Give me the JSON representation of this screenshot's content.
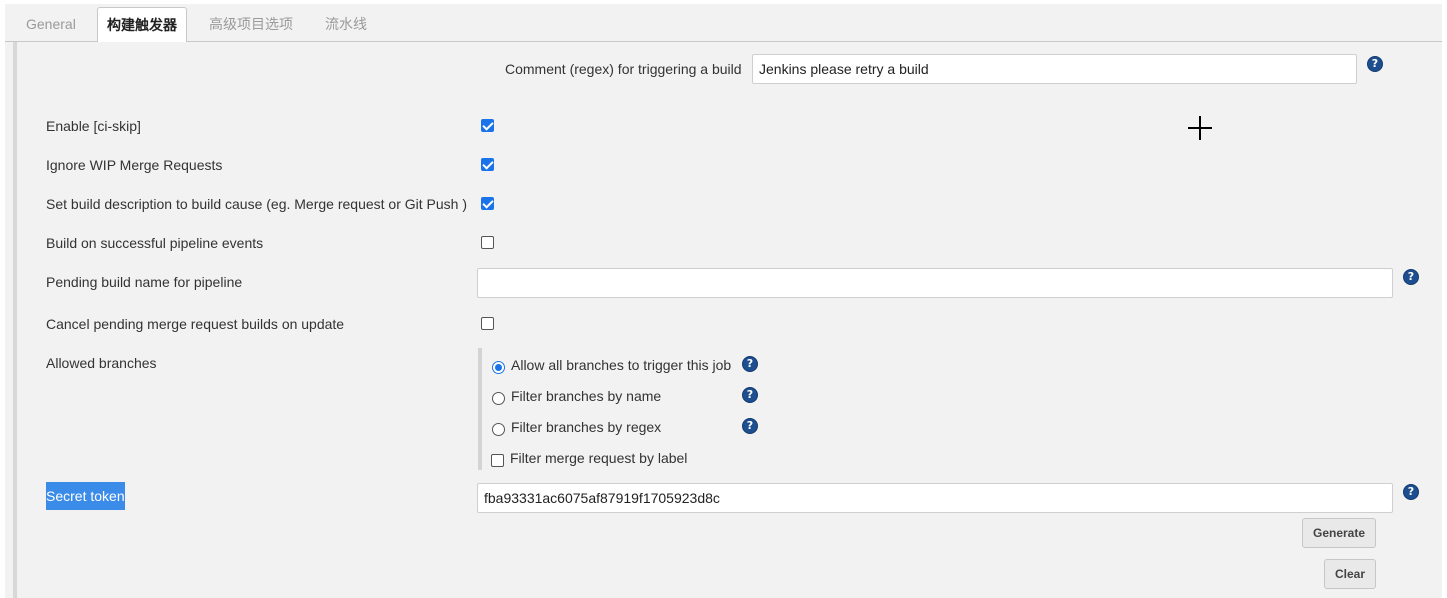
{
  "tabs": [
    {
      "label": "General"
    },
    {
      "label": "构建触发器"
    },
    {
      "label": "高级项目选项"
    },
    {
      "label": "流水线"
    }
  ],
  "comment_regex": {
    "label": "Comment (regex) for triggering a build",
    "value": "Jenkins please retry a build"
  },
  "options": {
    "ci_skip": {
      "label": "Enable [ci-skip]",
      "checked": true
    },
    "ignore_wip": {
      "label": "Ignore WIP Merge Requests",
      "checked": true
    },
    "set_description": {
      "label": "Set build description to build cause (eg. Merge request or Git Push )",
      "checked": true
    },
    "pipeline_events": {
      "label": "Build on successful pipeline events",
      "checked": false
    },
    "cancel_pending": {
      "label": "Cancel pending merge request builds on update",
      "checked": false
    }
  },
  "pending_build": {
    "label": "Pending build name for pipeline",
    "value": ""
  },
  "allowed_branches": {
    "label": "Allowed branches",
    "options": [
      {
        "label": "Allow all branches to trigger this job",
        "selected": true
      },
      {
        "label": "Filter branches by name",
        "selected": false
      },
      {
        "label": "Filter branches by regex",
        "selected": false
      }
    ],
    "merge_label_filter": {
      "label": "Filter merge request by label",
      "checked": false
    }
  },
  "secret_token": {
    "label": "Secret token",
    "value": "fba93331ac6075af87919f1705923d8c"
  },
  "buttons": {
    "generate": "Generate",
    "clear": "Clear"
  },
  "help_glyph": "?",
  "colors": {
    "accent": "#1a73e8",
    "highlight": "#3b8ce8",
    "help_icon": "#1d4e8f"
  }
}
